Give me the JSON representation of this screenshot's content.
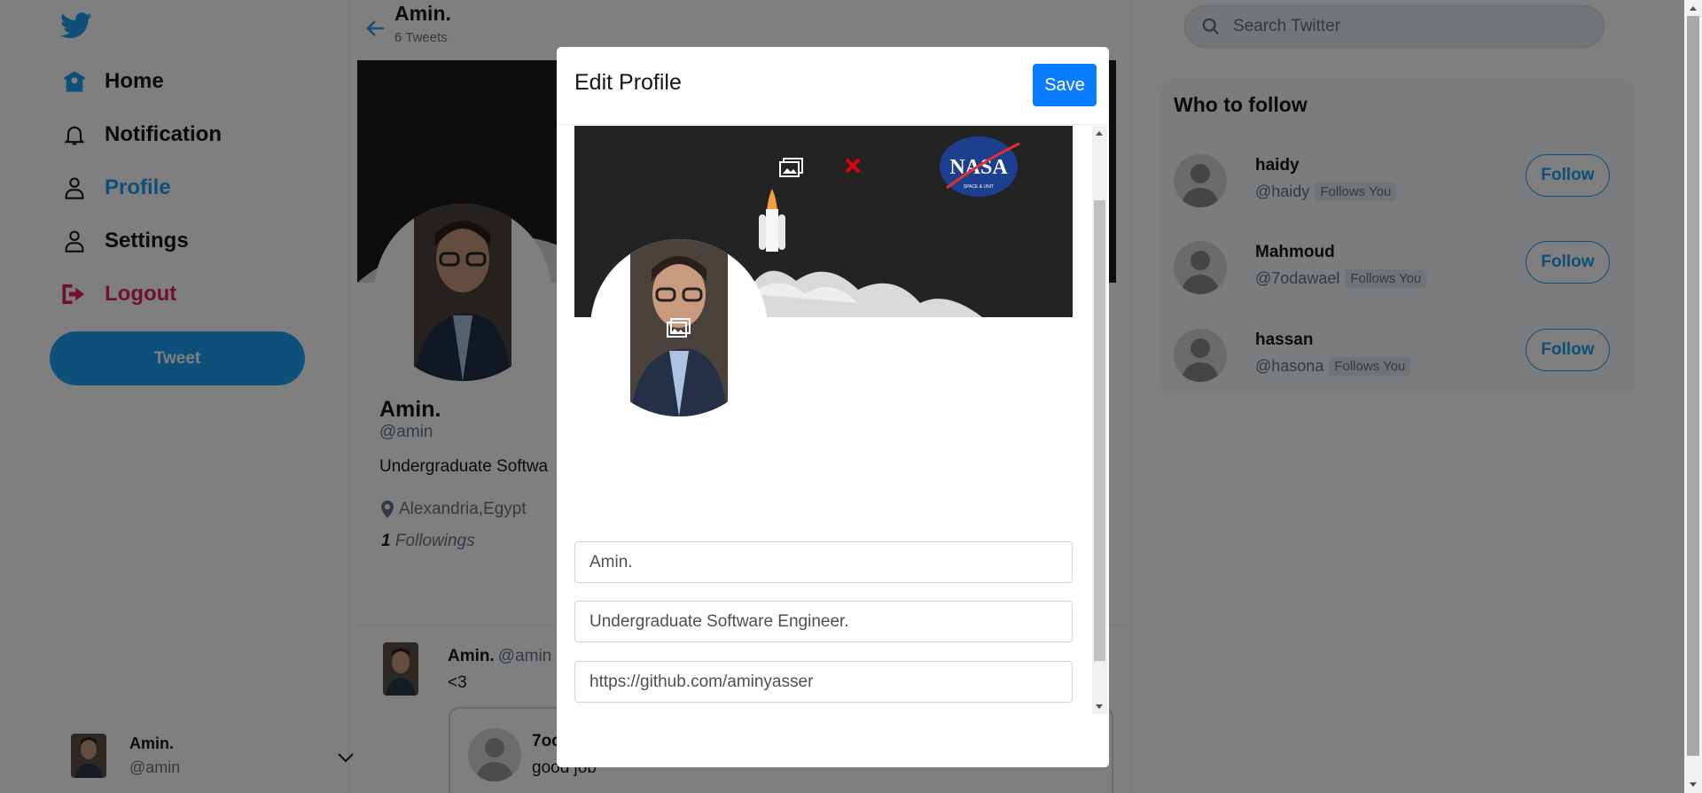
{
  "nav": {
    "logo_icon": "twitter-bird-icon",
    "items": [
      {
        "label": "Home",
        "icon": "home-icon"
      },
      {
        "label": "Notification",
        "icon": "bell-icon"
      },
      {
        "label": "Profile",
        "icon": "user-icon"
      },
      {
        "label": "Settings",
        "icon": "user-icon"
      },
      {
        "label": "Logout",
        "icon": "logout-icon"
      }
    ],
    "tweet_label": "Tweet"
  },
  "account": {
    "name": "Amin.",
    "handle": "@amin"
  },
  "profile_header": {
    "name": "Amin.",
    "tweet_count": "6 Tweets"
  },
  "profile": {
    "name": "Amin.",
    "handle": "@amin",
    "bio": "Undergraduate Softwa",
    "location": "Alexandria,Egypt",
    "following_count": "1",
    "following_label": "Followings"
  },
  "tweet": {
    "name": "Amin.",
    "handle": "@amin",
    "text": "<3"
  },
  "quoted": {
    "name": "7oc",
    "text": "good job"
  },
  "search": {
    "placeholder": "Search Twitter"
  },
  "who_to_follow": {
    "title": "Who to follow",
    "users": [
      {
        "name": "haidy",
        "handle": "@haidy",
        "badge": "Follows You",
        "button": "Follow"
      },
      {
        "name": "Mahmoud",
        "handle": "@7odawael",
        "badge": "Follows You",
        "button": "Follow"
      },
      {
        "name": "hassan",
        "handle": "@hasona",
        "badge": "Follows You",
        "button": "Follow"
      }
    ]
  },
  "modal": {
    "title": "Edit Profile",
    "save_label": "Save",
    "fields": {
      "name": "Amin.",
      "bio": "Undergraduate Software Engineer.",
      "website": "https://github.com/aminyasser",
      "location": "Alexandria,Egypt"
    }
  },
  "colors": {
    "accent": "#1da1f2",
    "logout": "#e0245e",
    "save": "#0a7cff",
    "close": "#e0000f"
  }
}
